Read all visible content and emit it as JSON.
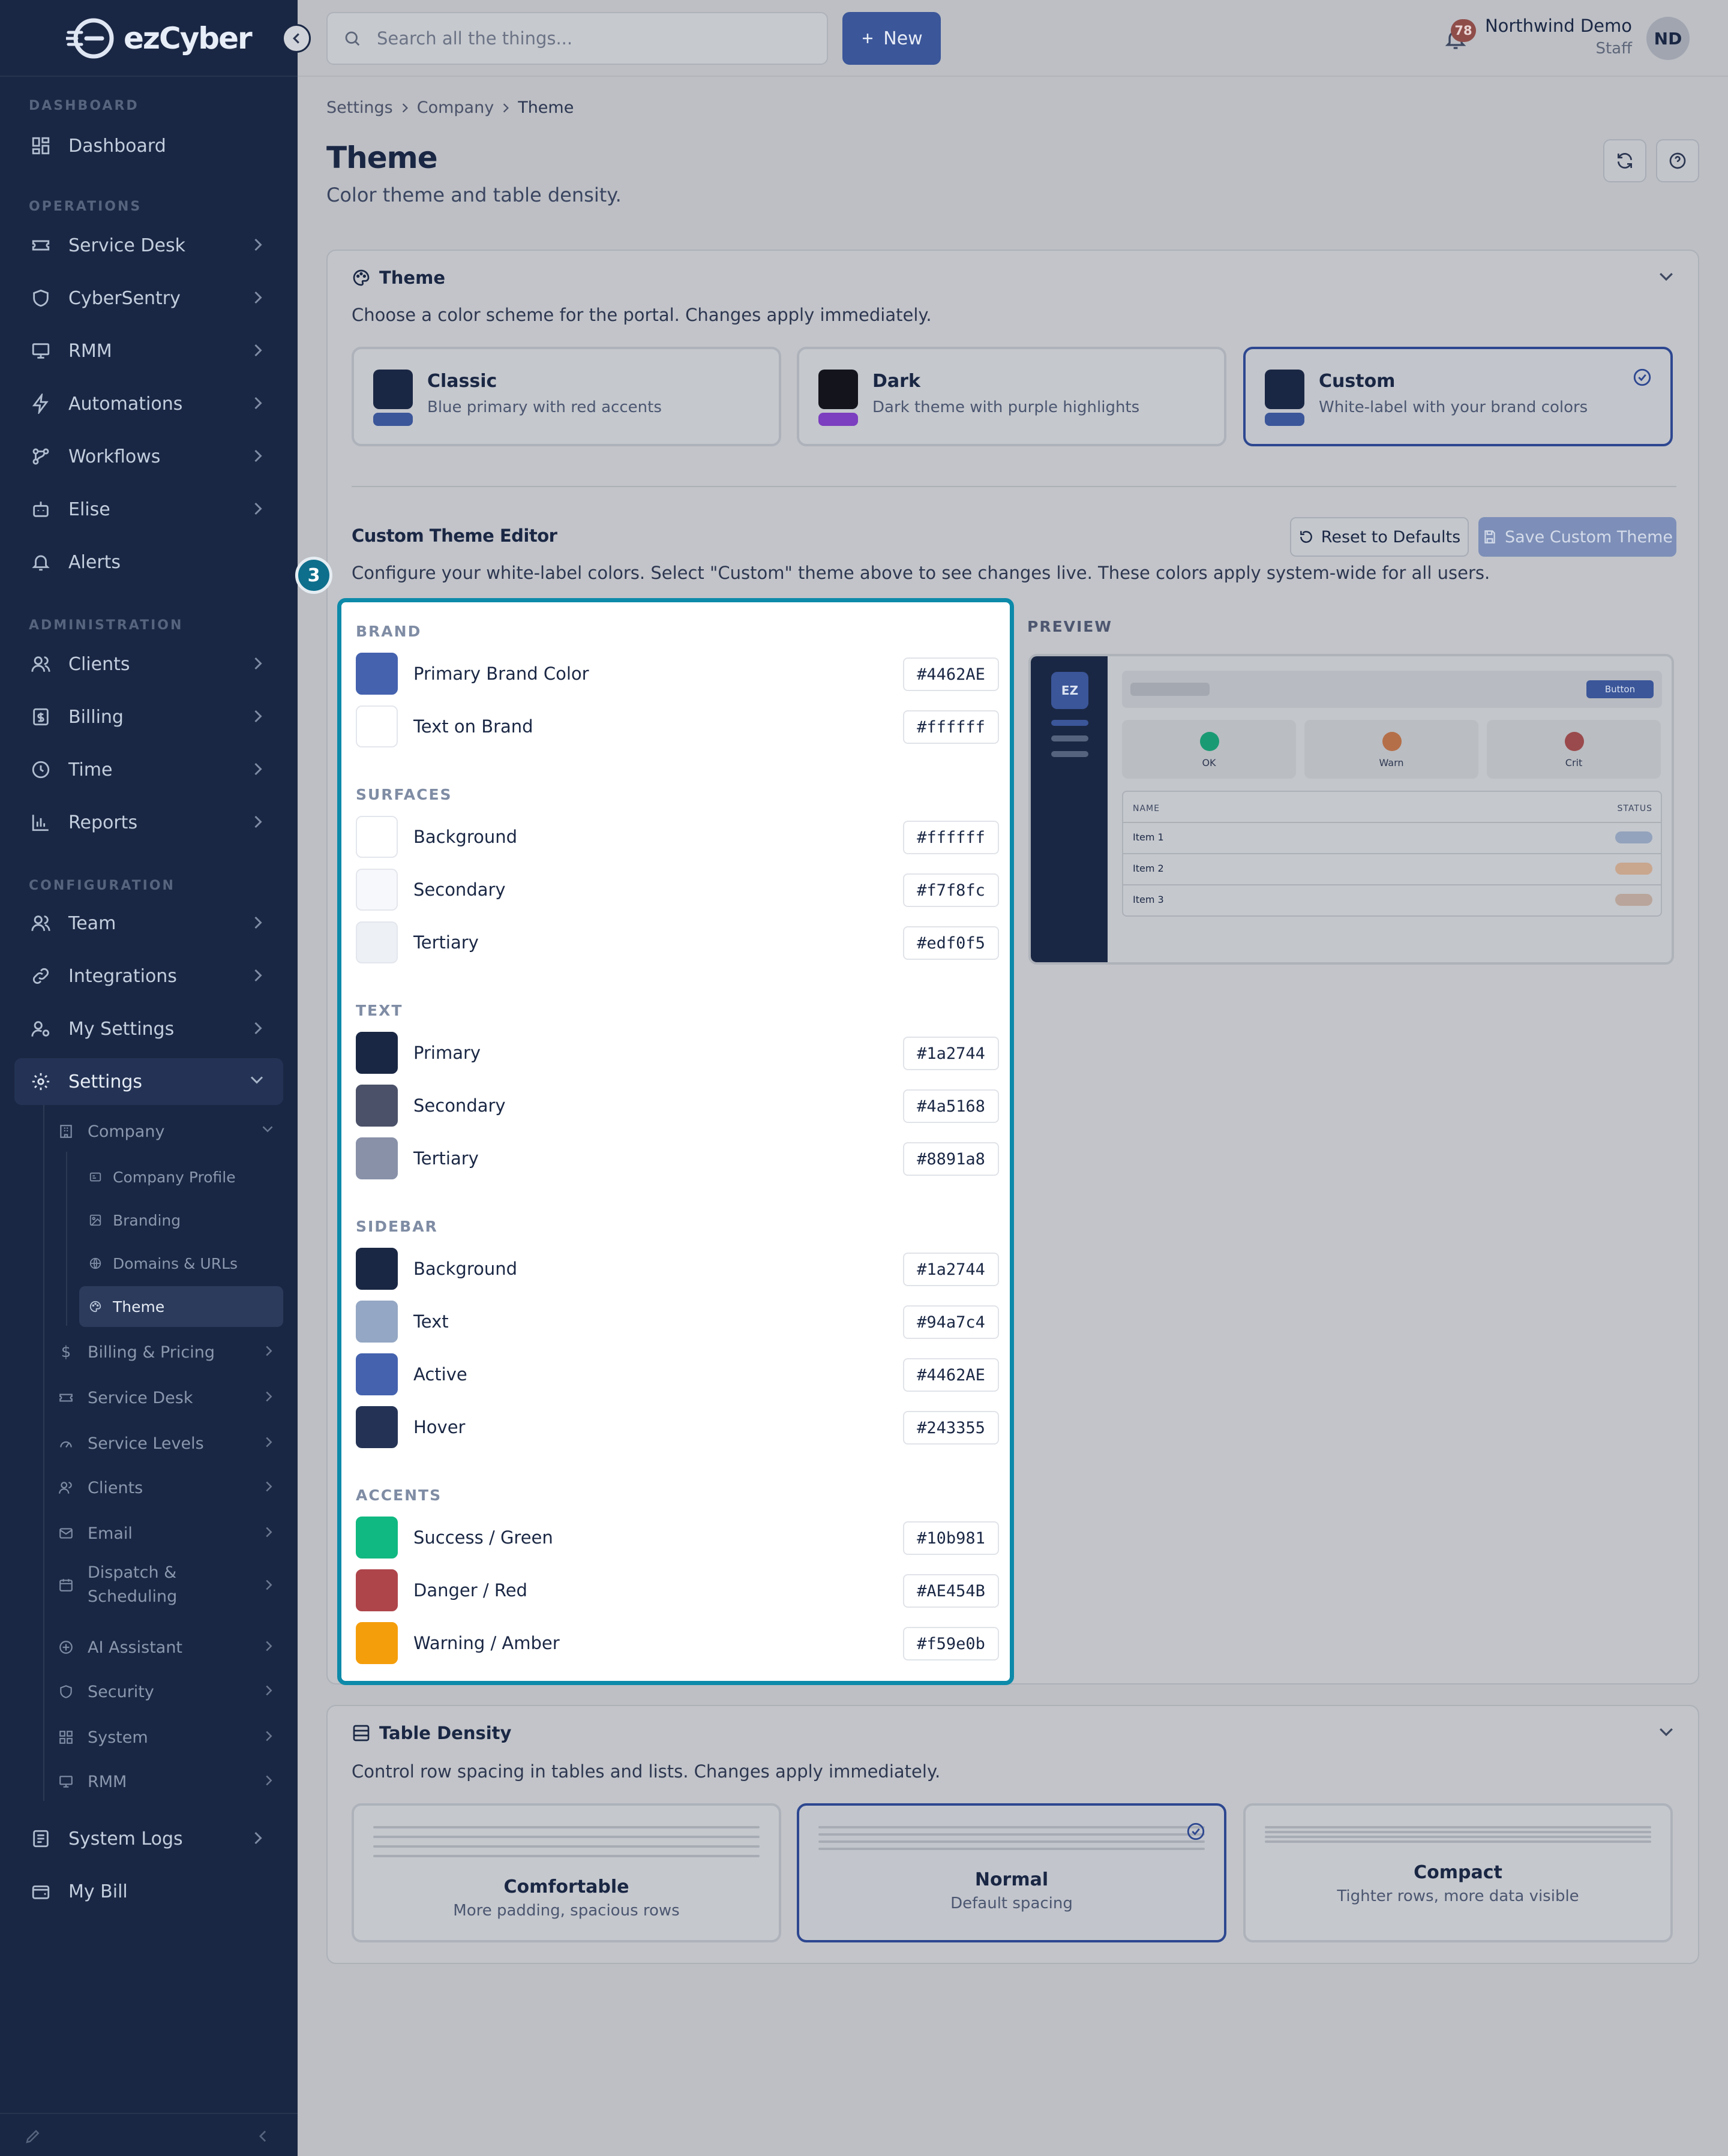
{
  "app": {
    "logo_text": "ezCyber"
  },
  "sidebar": {
    "sections": {
      "dashboard": "DASHBOARD",
      "operations": "OPERATIONS",
      "administration": "ADMINISTRATION",
      "configuration": "CONFIGURATION"
    },
    "items": {
      "dashboard": "Dashboard",
      "service_desk": "Service Desk",
      "cybersentry": "CyberSentry",
      "rmm": "RMM",
      "automations": "Automations",
      "workflows": "Workflows",
      "elise": "Elise",
      "alerts": "Alerts",
      "clients": "Clients",
      "billing": "Billing",
      "time": "Time",
      "reports": "Reports",
      "team": "Team",
      "integrations": "Integrations",
      "my_settings": "My Settings",
      "settings": "Settings",
      "system_logs": "System Logs",
      "my_bill": "My Bill"
    },
    "settings_sub": {
      "company": "Company",
      "company_profile": "Company Profile",
      "branding": "Branding",
      "domains": "Domains & URLs",
      "theme": "Theme",
      "billing_pricing": "Billing & Pricing",
      "service_desk": "Service Desk",
      "service_levels": "Service Levels",
      "clients": "Clients",
      "email": "Email",
      "dispatch_1": "Dispatch &",
      "dispatch_2": "Scheduling",
      "ai_assistant": "AI Assistant",
      "security": "Security",
      "system": "System",
      "rmm": "RMM"
    }
  },
  "topbar": {
    "search_placeholder": "Search all the things...",
    "new_label": "New",
    "notifications_count": "78",
    "user_name": "Northwind Demo",
    "user_role": "Staff",
    "user_initials": "ND"
  },
  "breadcrumb": [
    "Settings",
    "Company",
    "Theme"
  ],
  "page": {
    "title": "Theme",
    "subtitle": "Color theme and table density."
  },
  "theme_card": {
    "title": "Theme",
    "description": "Choose a color scheme for the portal. Changes apply immediately.",
    "options": [
      {
        "name": "Classic",
        "desc": "Blue primary with red accents",
        "swatch": "#1a2744",
        "bar": "#3b5699"
      },
      {
        "name": "Dark",
        "desc": "Dark theme with purple highlights",
        "swatch": "#13141c",
        "bar": "#7c3fc0"
      },
      {
        "name": "Custom",
        "desc": "White-label with your brand colors",
        "swatch": "#1a2744",
        "bar": "#3b5699",
        "selected": true
      }
    ]
  },
  "editor": {
    "title": "Custom Theme Editor",
    "reset_label": "Reset to Defaults",
    "save_label": "Save Custom Theme",
    "description": "Configure your white-label colors. Select \"Custom\" theme above to see changes live. These colors apply system-wide for all users.",
    "step_marker": "3",
    "groups": {
      "brand": {
        "label": "BRAND",
        "colors": [
          {
            "label": "Primary Brand Color",
            "hex": "#4462AE"
          },
          {
            "label": "Text on Brand",
            "hex": "#ffffff"
          }
        ]
      },
      "surfaces": {
        "label": "SURFACES",
        "colors": [
          {
            "label": "Background",
            "hex": "#ffffff"
          },
          {
            "label": "Secondary",
            "hex": "#f7f8fc"
          },
          {
            "label": "Tertiary",
            "hex": "#edf0f5"
          }
        ]
      },
      "text": {
        "label": "TEXT",
        "colors": [
          {
            "label": "Primary",
            "hex": "#1a2744"
          },
          {
            "label": "Secondary",
            "hex": "#4a5168"
          },
          {
            "label": "Tertiary",
            "hex": "#8891a8"
          }
        ]
      },
      "sidebar": {
        "label": "SIDEBAR",
        "colors": [
          {
            "label": "Background",
            "hex": "#1a2744"
          },
          {
            "label": "Text",
            "hex": "#94a7c4"
          },
          {
            "label": "Active",
            "hex": "#4462AE"
          },
          {
            "label": "Hover",
            "hex": "#243355"
          }
        ]
      },
      "accents": {
        "label": "ACCENTS",
        "colors": [
          {
            "label": "Success / Green",
            "hex": "#10b981"
          },
          {
            "label": "Danger / Red",
            "hex": "#AE454B"
          },
          {
            "label": "Warning / Amber",
            "hex": "#f59e0b"
          }
        ]
      }
    },
    "preview": {
      "label": "PREVIEW",
      "logo": "EZ",
      "button": "Button",
      "stats": [
        "OK",
        "Warn",
        "Crit"
      ],
      "table_headers": [
        "NAME",
        "STATUS"
      ],
      "rows": [
        "Item 1",
        "Item 2",
        "Item 3"
      ]
    }
  },
  "density_card": {
    "title": "Table Density",
    "description": "Control row spacing in tables and lists. Changes apply immediately.",
    "options": [
      {
        "name": "Comfortable",
        "desc": "More padding, spacious rows"
      },
      {
        "name": "Normal",
        "desc": "Default spacing",
        "selected": true
      },
      {
        "name": "Compact",
        "desc": "Tighter rows, more data visible"
      }
    ]
  }
}
